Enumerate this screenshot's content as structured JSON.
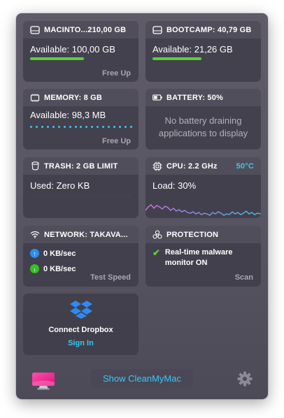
{
  "disk1": {
    "title": "MACINTO...210,00 GB",
    "available": "Available: 100,00 GB",
    "fill": 0.53,
    "action": "Free Up"
  },
  "disk2": {
    "title": "BOOTCAMP: 40,79 GB",
    "available": "Available: 21,26 GB",
    "fill": 0.48
  },
  "memory": {
    "title": "MEMORY: 8 GB",
    "available": "Available: 98,3 MB",
    "action": "Free Up"
  },
  "battery": {
    "title": "BATTERY: 50%",
    "message_line1": "No battery draining",
    "message_line2": "applications to display"
  },
  "trash": {
    "title": "TRASH: 2 GB LIMIT",
    "used": "Used: Zero KB"
  },
  "cpu": {
    "title": "CPU: 2.2 GHz",
    "temp": "50°C",
    "load": "Load: 30%"
  },
  "network": {
    "title": "NETWORK: TAKAVA...",
    "upload": "0 KB/sec",
    "download": "0 KB/sec",
    "action": "Test Speed"
  },
  "protection": {
    "title": "PROTECTION",
    "status_line1": "Real-time malware",
    "status_line2": "monitor ON",
    "action": "Scan"
  },
  "dropbox": {
    "title": "Connect Dropbox",
    "link": "Sign In"
  },
  "footer": {
    "show_button": "Show CleanMyMac"
  },
  "colors": {
    "accent": "#38c8f0",
    "green": "#5ad03a",
    "upload": "#2d8cf0",
    "download": "#34c021"
  },
  "icons": [
    "disk-icon",
    "memory-chip-icon",
    "battery-icon",
    "trash-icon",
    "cpu-icon",
    "wifi-icon",
    "biohazard-icon",
    "dropbox-icon",
    "cleanmymac-logo-icon",
    "gear-icon"
  ]
}
